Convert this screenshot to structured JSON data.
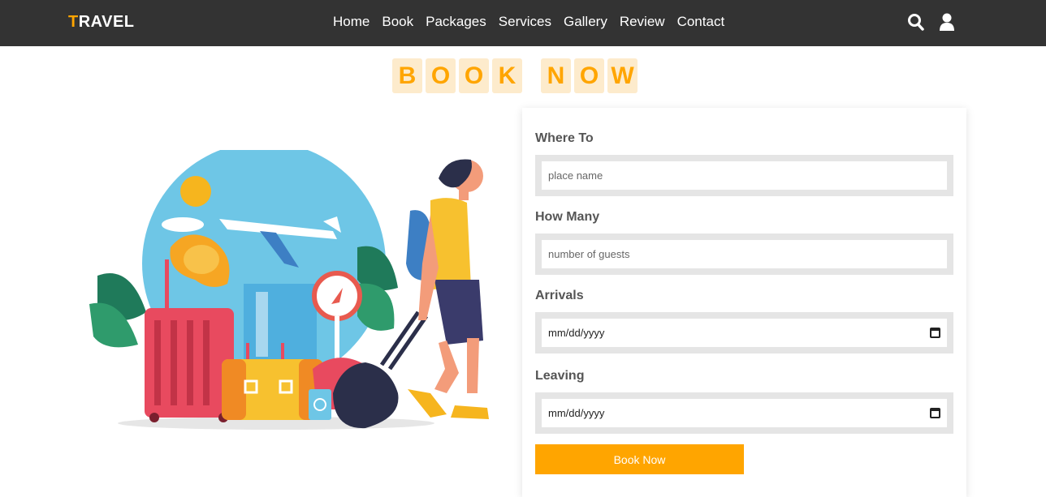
{
  "header": {
    "logo_first": "T",
    "logo_rest": "RAVEL",
    "nav": [
      "Home",
      "Book",
      "Packages",
      "Services",
      "Gallery",
      "Review",
      "Contact"
    ],
    "icons": [
      "search-icon",
      "user-icon"
    ]
  },
  "heading": {
    "letters": [
      "B",
      "O",
      "O",
      "K",
      "",
      "N",
      "O",
      "W"
    ]
  },
  "form": {
    "where_label": "Where To",
    "where_placeholder": "place name",
    "how_label": "How Many",
    "how_placeholder": "number of guests",
    "arrivals_label": "Arrivals",
    "arrivals_value": "mm/dd/yyyy",
    "leaving_label": "Leaving",
    "leaving_value": "mm/dd/yyyy",
    "button_label": "Book Now"
  },
  "colors": {
    "accent": "#ffa500",
    "header_bg": "#333333"
  }
}
